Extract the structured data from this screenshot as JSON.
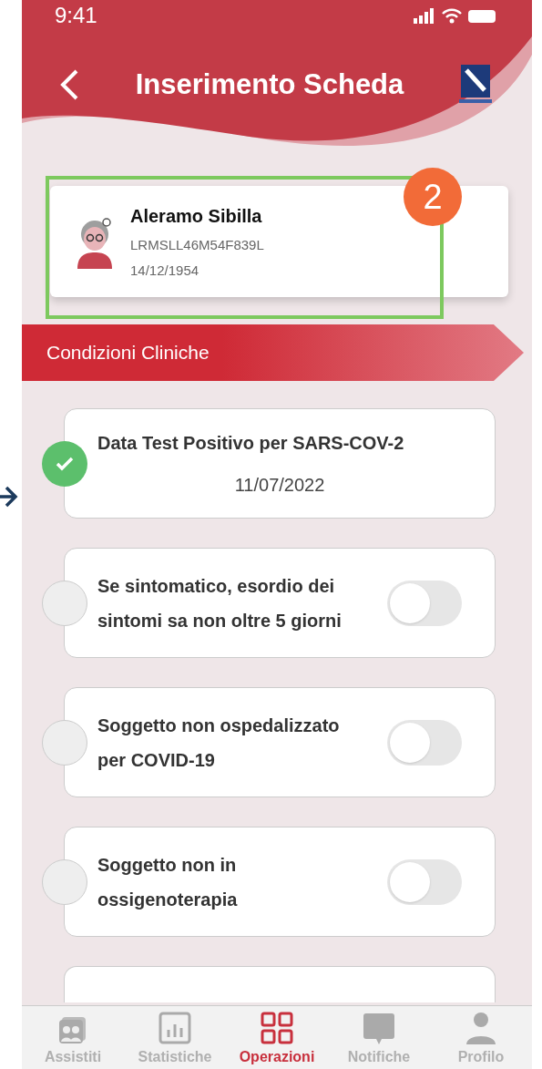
{
  "status_bar": {
    "time": "9:41"
  },
  "header": {
    "title": "Inserimento Scheda"
  },
  "patient": {
    "name": "Aleramo Sibilla",
    "code": "LRMSLL46M54F839L",
    "birth_date": "14/12/1954"
  },
  "annotation": {
    "badge": "2"
  },
  "section": {
    "title": "Condizioni Cliniche"
  },
  "conditions": [
    {
      "kind": "date",
      "label": "Data Test Positivo per SARS-COV-2",
      "value": "11/07/2022",
      "checked": true
    },
    {
      "kind": "toggle",
      "label": "Se sintomatico, esordio dei sintomi sa non oltre 5 giorni",
      "checked": false,
      "on": false
    },
    {
      "kind": "toggle",
      "label": "Soggetto non ospedalizzato per COVID-19",
      "checked": false,
      "on": false
    },
    {
      "kind": "toggle",
      "label": "Soggetto non in ossigenoterapia",
      "checked": false,
      "on": false
    }
  ],
  "tab_bar": [
    {
      "label": "Assistiti",
      "selected": false
    },
    {
      "label": "Statistiche",
      "selected": false
    },
    {
      "label": "Operazioni",
      "selected": true
    },
    {
      "label": "Notifiche",
      "selected": false
    },
    {
      "label": "Profilo",
      "selected": false
    }
  ]
}
